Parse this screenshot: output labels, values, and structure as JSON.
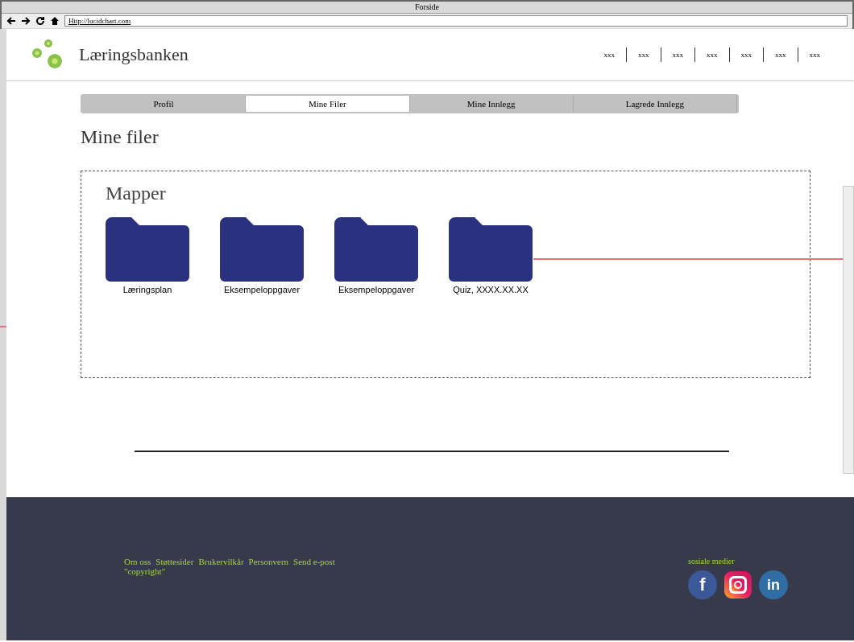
{
  "window": {
    "title": "Forside",
    "url": "Http://lucidchart.com"
  },
  "header": {
    "brand": "Læringsbanken",
    "nav": [
      "xxx",
      "xxx",
      "xxx",
      "xxx",
      "xxx",
      "xxx",
      "xxx"
    ]
  },
  "tabs": [
    {
      "label": "Profil",
      "selected": false
    },
    {
      "label": "Mine Filer",
      "selected": true
    },
    {
      "label": "Mine Innlegg",
      "selected": false
    },
    {
      "label": "Lagrede Innlegg",
      "selected": false
    }
  ],
  "page_title": "Mine filer",
  "folders": {
    "title": "Mapper",
    "items": [
      "Læringsplan",
      "Eksempeloppgaver",
      "Eksempeloppgaver",
      "Quiz, XXXX.XX.XX"
    ]
  },
  "footer": {
    "links": [
      "Om oss",
      "Støttesider",
      "Brukervilkår",
      "Personvern",
      "Send e-post"
    ],
    "copyright": "\"copyright\"",
    "social_title": "sosiale medier",
    "social": [
      {
        "kind": "facebook",
        "glyph": "f"
      },
      {
        "kind": "instagram"
      },
      {
        "kind": "linkedin",
        "glyph": "in"
      }
    ]
  }
}
